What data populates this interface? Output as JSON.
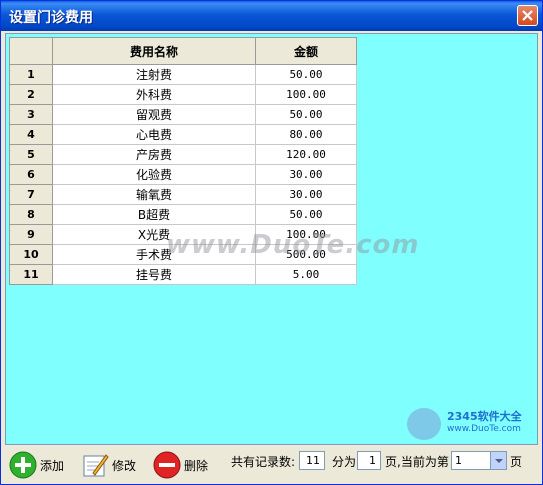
{
  "window": {
    "title": "设置门诊费用"
  },
  "table": {
    "headers": [
      "费用名称",
      "金额"
    ],
    "rows": [
      {
        "num": "1",
        "name": "注射费",
        "amount": "50.00"
      },
      {
        "num": "2",
        "name": "外科费",
        "amount": "100.00"
      },
      {
        "num": "3",
        "name": "留观费",
        "amount": "50.00"
      },
      {
        "num": "4",
        "name": "心电费",
        "amount": "80.00"
      },
      {
        "num": "5",
        "name": "产房费",
        "amount": "120.00"
      },
      {
        "num": "6",
        "name": "化验费",
        "amount": "30.00"
      },
      {
        "num": "7",
        "name": "输氧费",
        "amount": "30.00"
      },
      {
        "num": "8",
        "name": "B超费",
        "amount": "50.00"
      },
      {
        "num": "9",
        "name": "X光费",
        "amount": "100.00"
      },
      {
        "num": "10",
        "name": "手术费",
        "amount": "500.00"
      },
      {
        "num": "11",
        "name": "挂号费",
        "amount": "5.00"
      }
    ]
  },
  "watermark": "www.DuoTe.com",
  "logo": {
    "line1": "2345软件大全",
    "line2": "www.DuoTe.com"
  },
  "toolbar": {
    "add_label": "添加",
    "edit_label": "修改",
    "delete_label": "删除"
  },
  "pager": {
    "total_label": "共有记录数:",
    "total_value": "11",
    "split_label": "分为",
    "pages_value": "1",
    "current_label": "页,当前为第",
    "current_value": "1",
    "page_suffix": "页"
  }
}
